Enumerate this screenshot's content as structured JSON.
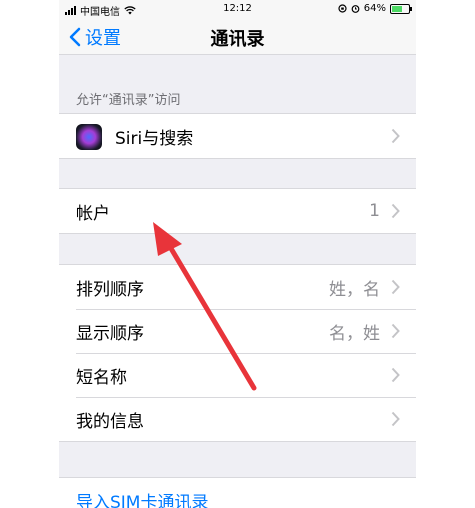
{
  "status_bar": {
    "carrier": "中国电信",
    "time": "12:12",
    "battery": "64%",
    "battery_level": 0.64
  },
  "nav": {
    "back_label": "设置",
    "title": "通讯录"
  },
  "sections": {
    "access_header": "允许“通讯录”访问",
    "siri": {
      "label": "Siri与搜索"
    },
    "accounts": {
      "label": "帐户",
      "value": "1"
    },
    "sort_order": {
      "label": "排列顺序",
      "value": "姓，名"
    },
    "display_order": {
      "label": "显示顺序",
      "value": "名，姓"
    },
    "short_name": {
      "label": "短名称"
    },
    "my_info": {
      "label": "我的信息"
    },
    "import_sim": {
      "label": "导入SIM卡通讯录"
    }
  },
  "colors": {
    "accent": "#007aff",
    "annotation_arrow": "#e8343a"
  },
  "icons": [
    "wifi-icon",
    "back-chevron-icon",
    "siri-icon",
    "chevron-right-icon",
    "alarm-icon",
    "lock-rotation-icon"
  ]
}
